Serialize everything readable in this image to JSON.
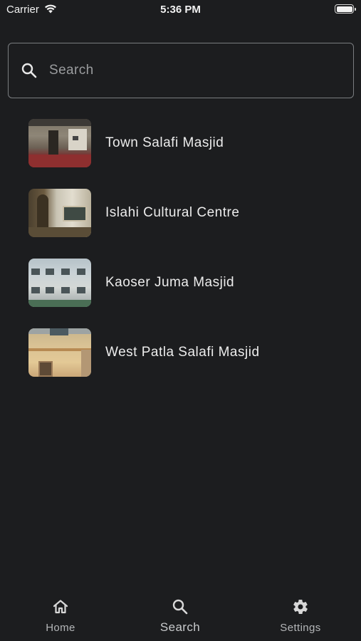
{
  "status_bar": {
    "carrier": "Carrier",
    "time": "5:36 PM"
  },
  "search": {
    "placeholder": "Search",
    "value": ""
  },
  "masjids": [
    {
      "name": "Town Salafi Masjid",
      "image": "town-salafi-masjid-photo"
    },
    {
      "name": "Islahi Cultural Centre",
      "image": "islahi-cultural-centre-photo"
    },
    {
      "name": "Kaoser Juma Masjid",
      "image": "kaoser-juma-masjid-photo"
    },
    {
      "name": "West Patla Salafi Masjid",
      "image": "west-patla-salafi-masjid-photo"
    }
  ],
  "tab_bar": {
    "tabs": [
      {
        "label": "Home",
        "icon": "home-icon",
        "active": false
      },
      {
        "label": "Search",
        "icon": "search-icon",
        "active": true
      },
      {
        "label": "Settings",
        "icon": "gear-icon",
        "active": false
      }
    ]
  },
  "colors": {
    "background": "#1c1d1f",
    "text": "#ececec",
    "inactive_tab": "#b4b6b8",
    "search_border": "#7a7d80"
  }
}
